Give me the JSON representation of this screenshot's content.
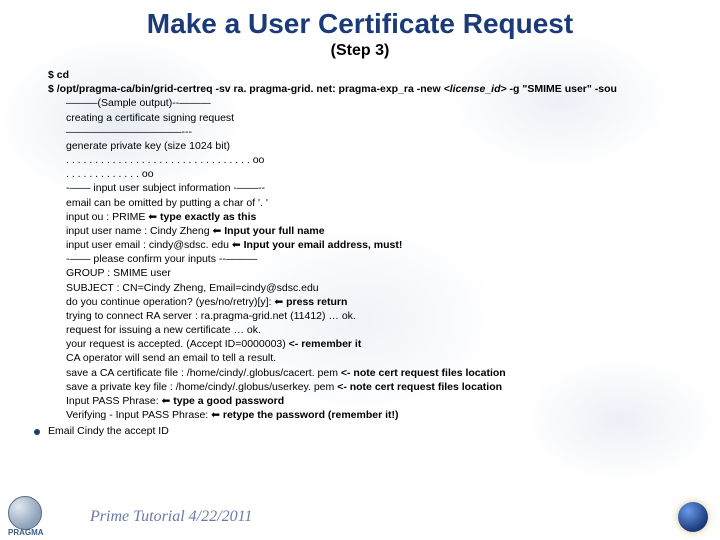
{
  "title": "Make a User Certificate Request",
  "subtitle": "(Step 3)",
  "lines": {
    "l1": "$ cd",
    "l2a": "$ /opt/pragma-ca/bin/grid-certreq -sv ra. pragma-grid. net: pragma-exp_ra -new ",
    "l2b": "<license_id>",
    "l2c": " -g \"SMIME user\" -sou",
    "l3": "———(Sample output)--———",
    "l4": "creating a certificate signing request",
    "l5": "———————————---",
    "l6": "generate private key (size 1024 bit)",
    "l7": ". . . . . . . . . . . . . . . . . . . . . . . . . . . . . . . . oo",
    "l8": ". . . . . . . . . . . . . oo",
    "l9": "-—— input user subject information -——--",
    "l10": "email can be omitted by putting a char of '. '",
    "l11a": "input ou : PRIME ",
    "l11b": " type exactly as this",
    "l12a": "input user name  : Cindy Zheng ",
    "l12b": " Input your full name",
    "l13a": "input user email : cindy@sdsc. edu ",
    "l13b": " Input your email address, must!",
    "l14": "-—— please confirm your inputs --———",
    "l15": "GROUP   : SMIME user",
    "l16": "SUBJECT : CN=Cindy Zheng, Email=cindy@sdsc.edu",
    "l17a": "do you continue operation? (yes/no/retry)[y]: ",
    "l17b": " press return",
    "l18": "trying to connect RA server : ra.pragma-grid.net (11412) … ok.",
    "l19": "request for issuing a new certificate … ok.",
    "l20a": "your request is accepted. (Accept ID=0000003) ",
    "l20b": "<- remember it",
    "l21": "CA operator will send an email to tell a result.",
    "l22a": "save a CA certificate file : /home/cindy/.globus/cacert. pem ",
    "l22b": "<- note cert request files location",
    "l23a": "save a private key file : /home/cindy/.globus/userkey. pem ",
    "l23b": "<- note cert request files location",
    "l24a": "Input PASS Phrase: ",
    "l24b": " type a good password",
    "l25a": "Verifying - Input PASS Phrase: ",
    "l25b": " retype the password (remember it!)",
    "l26": "Email Cindy the accept ID"
  },
  "arrow": "⬅",
  "footer": "Prime Tutorial 4/22/2011",
  "logo_text": "PRAGMA"
}
